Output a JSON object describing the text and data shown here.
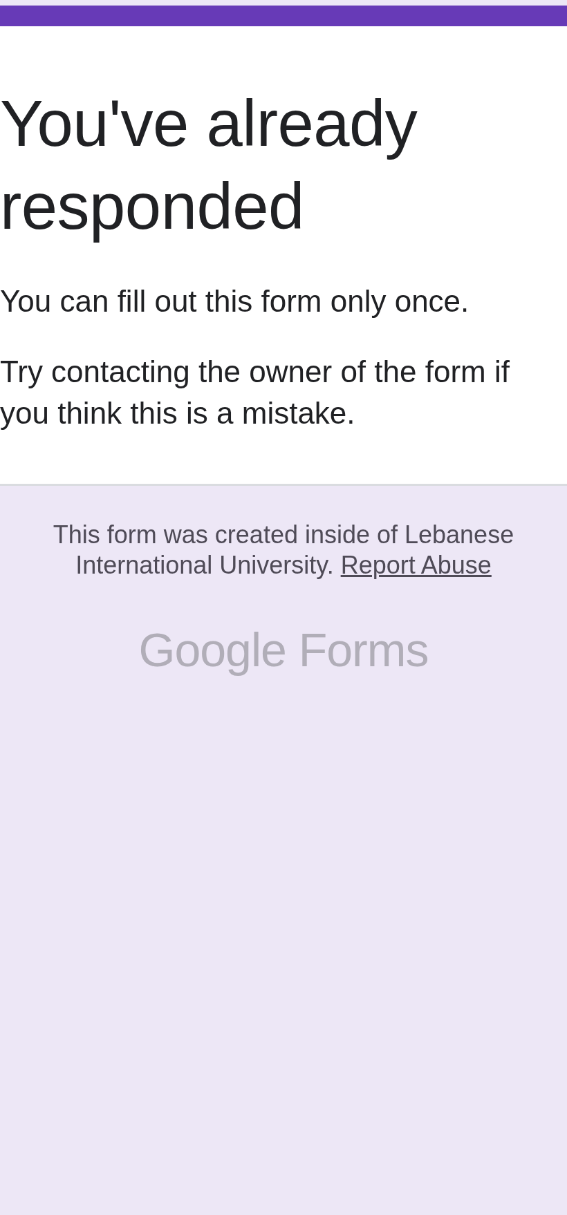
{
  "card": {
    "title": "You've already responded",
    "paragraphs": [
      "You can fill out this form only once.",
      "Try contacting the owner of the form if you think this is a mistake."
    ]
  },
  "footer": {
    "notice": "This form was created inside of Lebanese International University.",
    "link": "Report Abuse",
    "logo": "Google Forms"
  }
}
